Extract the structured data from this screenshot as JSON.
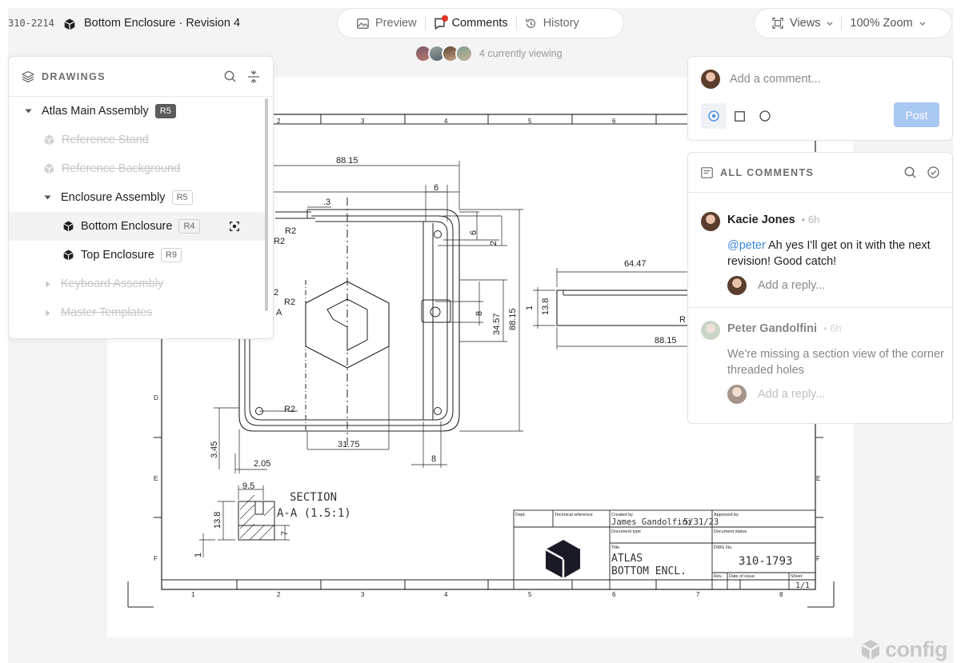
{
  "header": {
    "doc_id": "310-2214",
    "doc_title": "Bottom Enclosure · Revision 4"
  },
  "tabs": [
    {
      "label": "Preview",
      "icon": "image-icon",
      "active": false
    },
    {
      "label": "Comments",
      "icon": "comment-icon",
      "active": true
    },
    {
      "label": "History",
      "icon": "history-icon",
      "active": false
    }
  ],
  "view_controls": {
    "views_label": "Views",
    "zoom_label": "100% Zoom"
  },
  "viewers": {
    "text": "4 currently viewing"
  },
  "drawings_panel": {
    "title": "DRAWINGS",
    "items": [
      {
        "label": "Atlas Main Assembly",
        "badge": "R5",
        "level": 0,
        "state": "expanded",
        "muted": false
      },
      {
        "label": "Reference Stand",
        "badge": "",
        "level": 1,
        "state": "leaf",
        "muted": true
      },
      {
        "label": "Reference Background",
        "badge": "",
        "level": 1,
        "state": "leaf",
        "muted": true
      },
      {
        "label": "Enclosure Assembly",
        "badge": "R5",
        "level": 1,
        "state": "expanded",
        "muted": false
      },
      {
        "label": "Bottom Enclosure",
        "badge": "R4",
        "level": 2,
        "state": "leaf",
        "muted": false,
        "selected": true
      },
      {
        "label": "Top Enclosure",
        "badge": "R9",
        "level": 2,
        "state": "leaf",
        "muted": false
      },
      {
        "label": "Keyboard Assembly",
        "badge": "",
        "level": 1,
        "state": "collapsed",
        "muted": true
      },
      {
        "label": "Master Templates",
        "badge": "",
        "level": 1,
        "state": "collapsed",
        "muted": true
      }
    ]
  },
  "composer": {
    "placeholder": "Add a comment...",
    "post_label": "Post"
  },
  "comments_panel": {
    "title": "ALL COMMENTS",
    "comments": [
      {
        "author": "Kacie Jones",
        "time": "6h",
        "mention": "@peter",
        "body": " Ah yes I'll get on it with the next revision! Good catch!",
        "reply_placeholder": "Add a reply...",
        "resolved": false
      },
      {
        "author": "Peter Gandolfini",
        "time": "6h",
        "mention": "",
        "body": "We're missing a section view of the corner threaded holes",
        "reply_placeholder": "Add a reply...",
        "resolved": true
      }
    ]
  },
  "drawing": {
    "col_labels": [
      "1",
      "2",
      "3",
      "4",
      "5",
      "6",
      "7",
      "8"
    ],
    "row_labels": [
      "D",
      "E",
      "F"
    ],
    "dimensions": [
      "88.15",
      "6",
      ".3",
      "R2",
      "R2",
      "6",
      "2",
      "2",
      "R2",
      "A",
      "8",
      "34.57",
      "88.15",
      "R2",
      "31.75",
      "3.45",
      "2.05",
      "8",
      "64.47",
      "1",
      "13.8",
      "R",
      "88.15",
      "9.5",
      "13.8",
      "7",
      "1"
    ],
    "section_label": "SECTION",
    "section_scale": "A-A (1.5:1)",
    "title_block": {
      "dept_label": "Dept.",
      "tech_ref_label": "Technical reference",
      "created_by_label": "Created by",
      "created_by": "James Gandolfini",
      "created_date": "5/31/23",
      "approved_by_label": "Approved by",
      "doc_type_label": "Document type",
      "doc_status_label": "Document status",
      "title_label": "Title",
      "title_line1": "ATLAS",
      "title_line2": "BOTTOM ENCL.",
      "dwg_no_label": "DWG No.",
      "dwg_no": "310-1793",
      "rev_label": "Rev.",
      "date_issue_label": "Date of issue",
      "sheet_label": "Sheet",
      "sheet": "1/1"
    }
  },
  "brand": {
    "name": "config"
  },
  "colors": {
    "accent": "#3d86de",
    "post_button": "#a9c8f1",
    "alert_dot": "#e0332a"
  }
}
